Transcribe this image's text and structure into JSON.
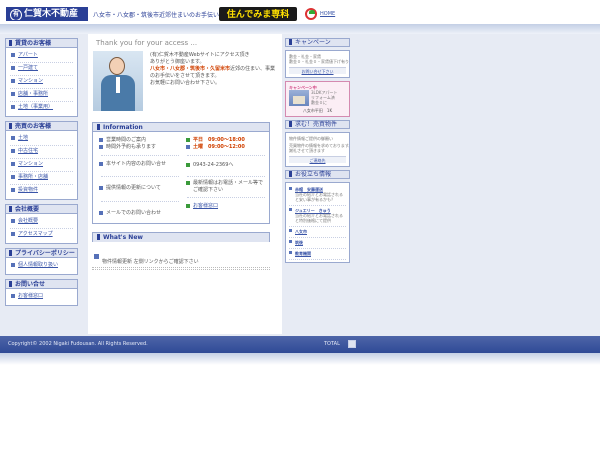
{
  "header": {
    "logo_mark": "有",
    "logo_text": "仁賀木不動産",
    "tagline": "八女市・八女郡・筑後市近郊住まいのお手伝い",
    "brand": "住んでみま専科",
    "home": "HOME"
  },
  "left": {
    "rental": {
      "title": "賃貸のお客様",
      "items": [
        "アパート",
        "一戸建て",
        "マンション",
        "店舗・事務所",
        "土地（事業用）"
      ]
    },
    "sale": {
      "title": "売買のお客様",
      "items": [
        "土地",
        "中古住宅",
        "マンション",
        "事務所・店舗",
        "投資物件"
      ]
    },
    "company": {
      "title": "会社概要",
      "items": [
        "会社概要",
        "アクセスマップ"
      ]
    },
    "privacy": {
      "title": "プライバシーポリシー",
      "items": [
        "個人情報取り扱い"
      ]
    },
    "contact": {
      "title": "お問い合せ",
      "items": [
        "お客様窓口"
      ]
    }
  },
  "main": {
    "thanks": "Thank you for your access ...",
    "intro": {
      "line1": "(有)仁賀木不動産Webサイトにアクセス頂き",
      "line2": "ありがとう御座います。",
      "areas": "八女市・八女郡・筑後市・久留米市",
      "line3": "近郊の住まい、事業のお手伝いをさせて頂きます。",
      "line4": "お気軽にお問い合わせ下さい。"
    },
    "information": {
      "title": "Information",
      "hours_label": "営業時間のご案内",
      "hours_sub": "時間外予約も承ります",
      "weekday": "平日　09:00～18:00",
      "saturday": "土曜　09:00～12:00",
      "site_inquiry": "本サイト内容のお問い合せ",
      "phone": "0943-24-2369へ",
      "provide_update": "提供情報の更新について",
      "latest_info": "最新情報はお電話・メール等でご確認下さい",
      "email_contact": "メールでのお問い合わせ",
      "customer_window": "お客様窓口"
    },
    "whats_new": {
      "title": "What's New",
      "text": "物件情報更新 左側リンクからご確認下さい"
    }
  },
  "right": {
    "campaign": {
      "title": "キャンペーン",
      "card1_line1": "敷金・礼金・家賃",
      "card1_line2": "敷金０・礼金０・家賃値下げ有り",
      "card1_link": "お問い合せ下さい",
      "card2_title": "キャンペーン中",
      "card2_line1": "3LDKアパート",
      "card2_line2": "リフォーム済",
      "card2_line3": "敷金０に",
      "card2_price": "八女市平田　1K"
    },
    "wanted": {
      "title": "求む！売買物件",
      "line1": "物件情報ご提供の御願い",
      "line2": "売買物件の情報を求めております。",
      "line3": "謝礼させて頂きます",
      "link": "ご連絡先"
    },
    "useful": {
      "title": "お役立ち情報",
      "items": [
        {
          "title": "赤帽　安藤運送",
          "text": "当社の紹介とお電話されると安い事が有るかも？"
        },
        {
          "title": "ジュエリー　きゅう",
          "text": "当社の紹介とお電話されると特別価格にて提供"
        },
        {
          "title": "八女市",
          "text": ""
        },
        {
          "title": "筑後",
          "text": ""
        },
        {
          "title": "教育機関",
          "text": ""
        }
      ]
    }
  },
  "footer": {
    "copyright": "Copyright© 2002 Nigaki Fudousan. All Rights Reserved.",
    "total": "TOTAL"
  }
}
